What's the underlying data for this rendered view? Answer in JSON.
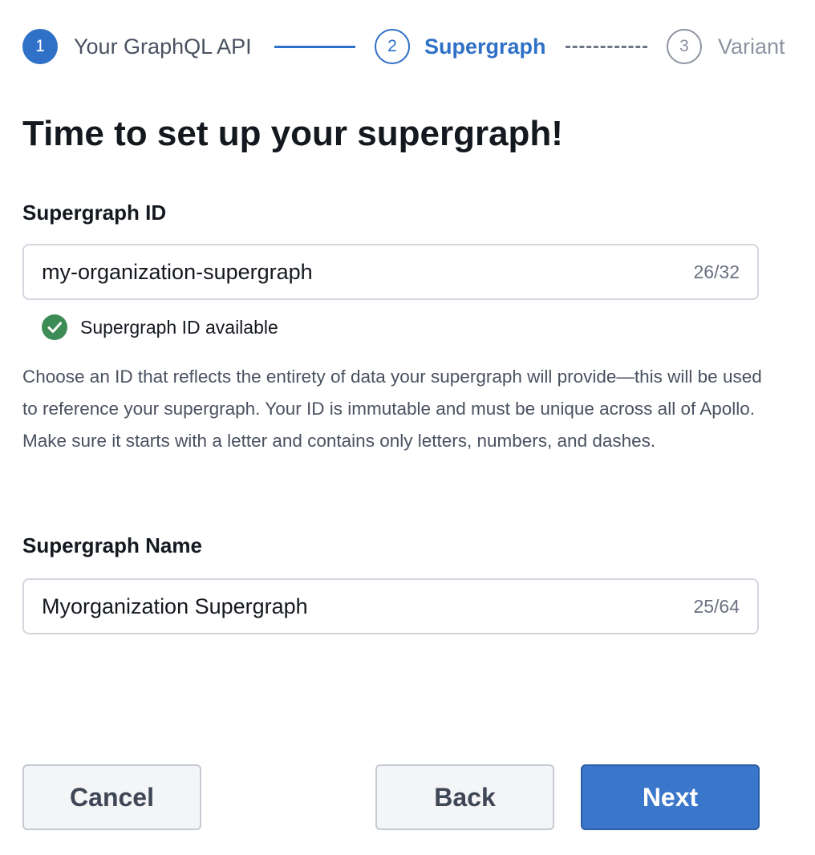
{
  "stepper": {
    "steps": [
      {
        "number": "1",
        "label": "Your GraphQL API",
        "state": "complete"
      },
      {
        "number": "2",
        "label": "Supergraph",
        "state": "active"
      },
      {
        "number": "3",
        "label": "Variant",
        "state": "upcoming"
      }
    ]
  },
  "page": {
    "title": "Time to set up your supergraph!"
  },
  "supergraph_id": {
    "label": "Supergraph ID",
    "value": "my-organization-supergraph",
    "char_count": "26/32",
    "validation_text": "Supergraph ID available",
    "validation_icon": "check-circle-icon",
    "help_text": "Choose an ID that reflects the entirety of data your supergraph will provide—this will be used to reference your supergraph. Your ID is immutable and must be unique across all of Apollo. Make sure it starts with a letter and contains only letters, numbers, and dashes."
  },
  "supergraph_name": {
    "label": "Supergraph Name",
    "value": "Myorganization Supergraph",
    "char_count": "25/64"
  },
  "actions": {
    "cancel_label": "Cancel",
    "back_label": "Back",
    "next_label": "Next"
  },
  "colors": {
    "primary": "#3071c8",
    "success": "#3d8b55",
    "muted": "#8c93a0"
  }
}
